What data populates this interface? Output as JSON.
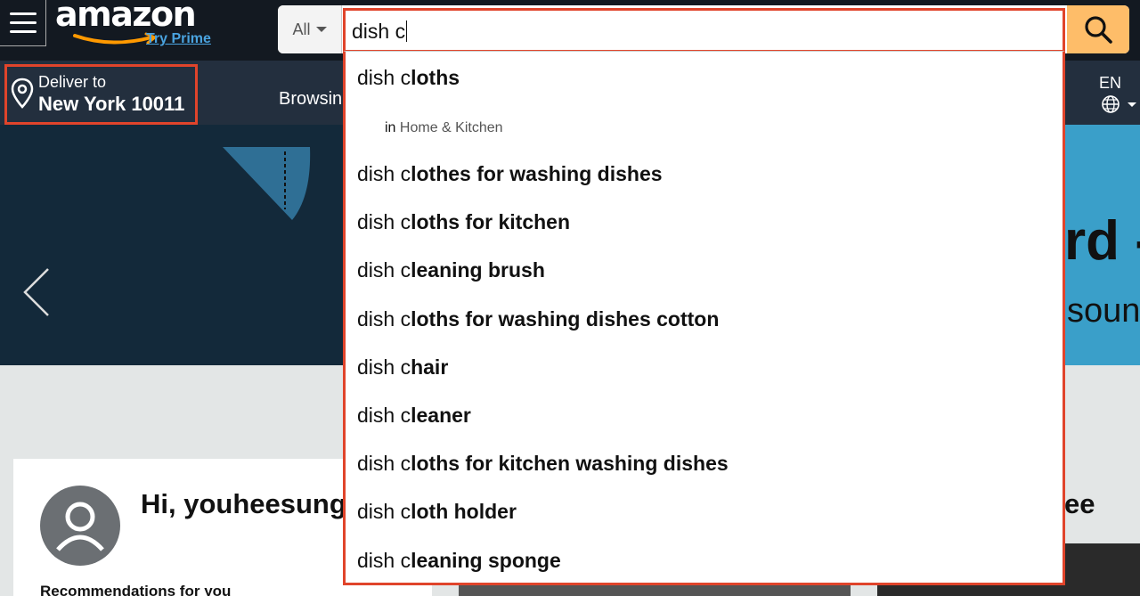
{
  "header": {
    "logo_text": "amazon",
    "try_prime": "Try Prime",
    "search": {
      "category": "All",
      "query": "dish c"
    },
    "deliver": {
      "line1": "Deliver to",
      "line2": "New York 10011"
    },
    "nav_partial": "Browsin",
    "language": "EN"
  },
  "hero": {
    "headline_partial": "rd -",
    "subline_partial": "soun"
  },
  "account": {
    "greeting": "Hi, youheesung",
    "recommendations": "Recommendations for you",
    "right_partial": "ee"
  },
  "suggestions": [
    {
      "prefix": "dish c",
      "rest": "loths"
    },
    {
      "sub_in": "in",
      "department": "Home & Kitchen"
    },
    {
      "prefix": "dish c",
      "rest": "lothes for washing dishes"
    },
    {
      "prefix": "dish c",
      "rest": "loths for kitchen"
    },
    {
      "prefix": "dish c",
      "rest": "leaning brush"
    },
    {
      "prefix": "dish c",
      "rest": "loths for washing dishes cotton"
    },
    {
      "prefix": "dish c",
      "rest": "hair"
    },
    {
      "prefix": "dish c",
      "rest": "leaner"
    },
    {
      "prefix": "dish c",
      "rest": "loths for kitchen washing dishes"
    },
    {
      "prefix": "dish c",
      "rest": "loth holder"
    },
    {
      "prefix": "dish c",
      "rest": "leaning sponge"
    }
  ],
  "colors": {
    "header_bg": "#131921",
    "subheader_bg": "#232f3e",
    "search_button": "#febd69",
    "highlight_border": "#e0442b",
    "prime_link": "#4aa3df"
  }
}
